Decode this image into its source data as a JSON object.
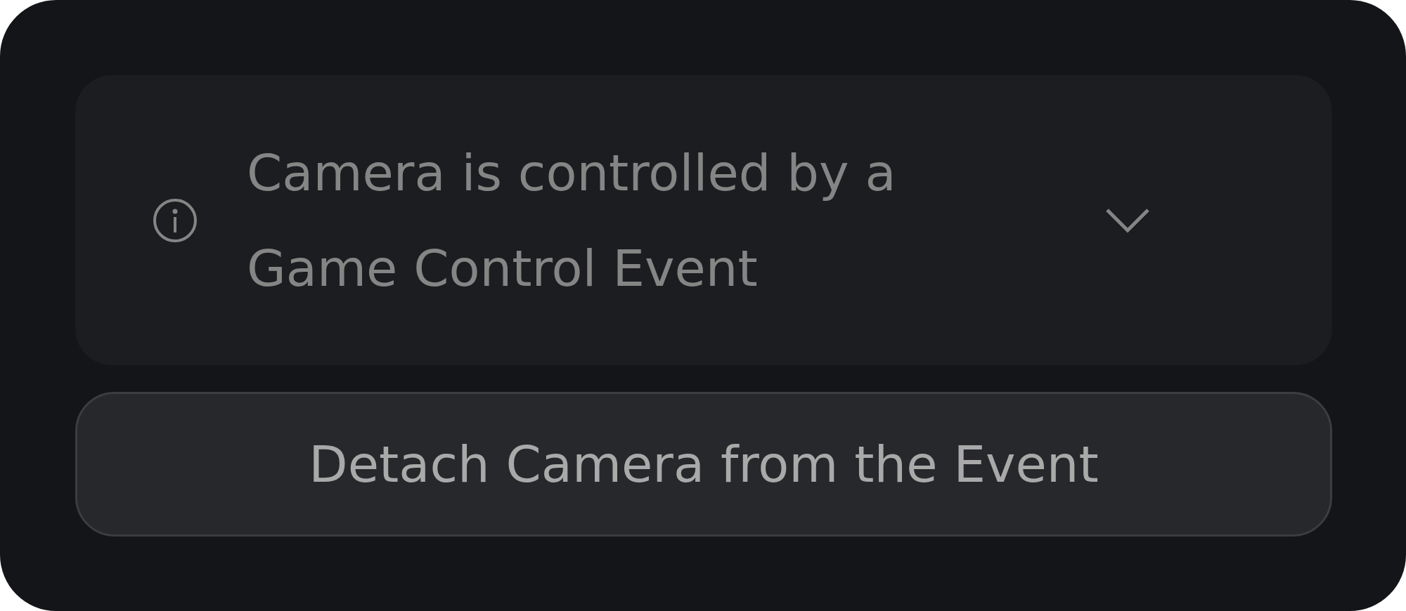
{
  "notice": {
    "message": "Camera is controlled by a Game Control Event",
    "expanded": false
  },
  "action_button": {
    "label": "Detach Camera from the Event"
  }
}
